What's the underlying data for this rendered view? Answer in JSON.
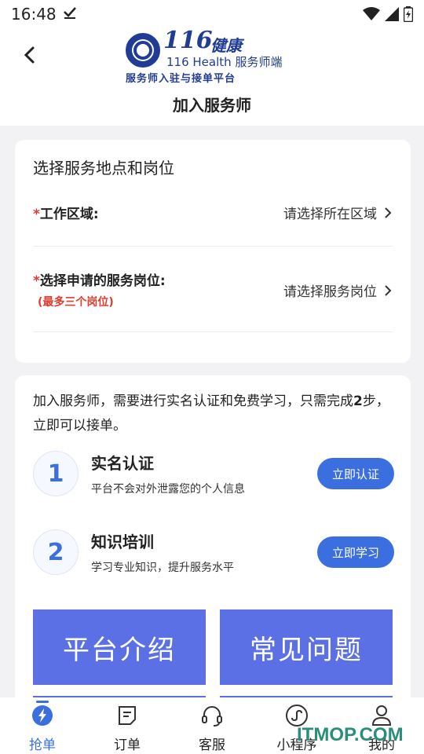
{
  "status_bar": {
    "time": "16:48"
  },
  "header": {
    "logo_number": "116",
    "logo_cn": "健康",
    "logo_en": "116 Health",
    "logo_role": "服务师端",
    "logo_tagline": "服务师入驻与接单平台",
    "title": "加入服务师"
  },
  "location_card": {
    "title": "选择服务地点和岗位",
    "required_mark": "*",
    "area_label": "工作区域:",
    "area_value": "请选择所在区域",
    "position_label": "选择申请的服务岗位:",
    "position_note": "(最多三个岗位)",
    "position_value": "请选择服务岗位"
  },
  "join_card": {
    "intro_pre": "加入服务师，需要进行实名认证和免费学习，只需完成",
    "intro_num": "2",
    "intro_post": "步，立即可以接单。",
    "steps": [
      {
        "num": "1",
        "title": "实名认证",
        "desc": "平台不会对外泄露您的个人信息",
        "button": "立即认证"
      },
      {
        "num": "2",
        "title": "知识培训",
        "desc": "学习专业知识，提升服务水平",
        "button": "立即学习"
      }
    ],
    "platform_intro": "平台介绍",
    "faq": "常见问题"
  },
  "tabbar": {
    "items": [
      {
        "label": "抢单",
        "icon": "lightning-icon"
      },
      {
        "label": "订单",
        "icon": "order-icon"
      },
      {
        "label": "客服",
        "icon": "headset-icon"
      },
      {
        "label": "小程序",
        "icon": "mini-program-icon"
      },
      {
        "label": "我的",
        "icon": "user-icon"
      }
    ]
  },
  "watermark": "ITMOP.COM",
  "colors": {
    "accent": "#3b6fe0",
    "big_button": "#5a70e4",
    "required": "#e23b2a",
    "logo": "#203c95"
  }
}
